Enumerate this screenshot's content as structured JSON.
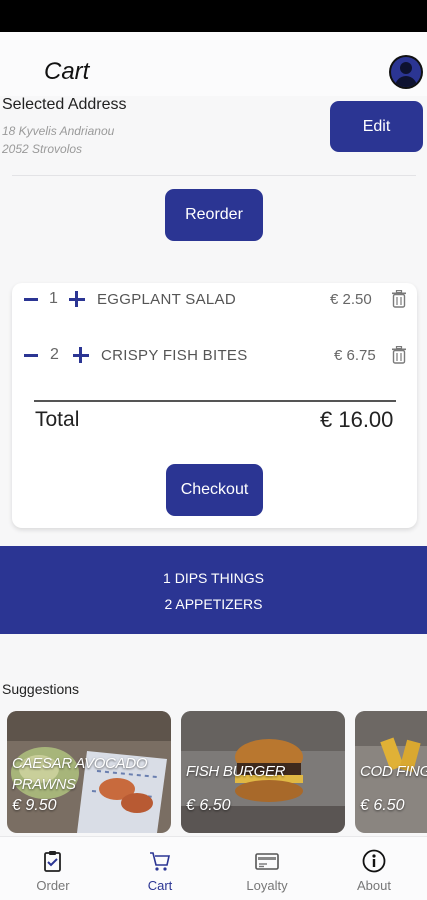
{
  "header": {
    "title": "Cart"
  },
  "address": {
    "title": "Selected Address",
    "line1": "18 Kyvelis Andrianou",
    "line2": "2052 Strovolos",
    "edit_label": "Edit"
  },
  "reorder_label": "Reorder",
  "cart": {
    "items": [
      {
        "qty": "1",
        "name": "EGGPLANT SALAD",
        "price": "€ 2.50"
      },
      {
        "qty": "2",
        "name": "CRISPY FISH BITES",
        "price": "€ 6.75"
      }
    ],
    "total_label": "Total",
    "total_value": "€ 16.00",
    "checkout_label": "Checkout"
  },
  "banner": {
    "line1": "1 DIPS  THINGS",
    "line2": "2  APPETIZERS"
  },
  "suggestions": {
    "title": "Suggestions",
    "items": [
      {
        "name": "CAESAR AVOCADO PRAWNS",
        "price": "€ 9.50"
      },
      {
        "name": "FISH BURGER",
        "price": "€ 6.50"
      },
      {
        "name": "COD FINGERS",
        "price": "€ 6.50"
      }
    ]
  },
  "bottom_nav": {
    "items": [
      {
        "label": "Order",
        "icon": "clipboard-icon"
      },
      {
        "label": "Cart",
        "icon": "cart-icon"
      },
      {
        "label": "Loyalty",
        "icon": "card-icon"
      },
      {
        "label": "About",
        "icon": "info-icon"
      }
    ],
    "active": "Cart"
  },
  "colors": {
    "primary": "#2b3593",
    "background": "#f7f7f8"
  }
}
